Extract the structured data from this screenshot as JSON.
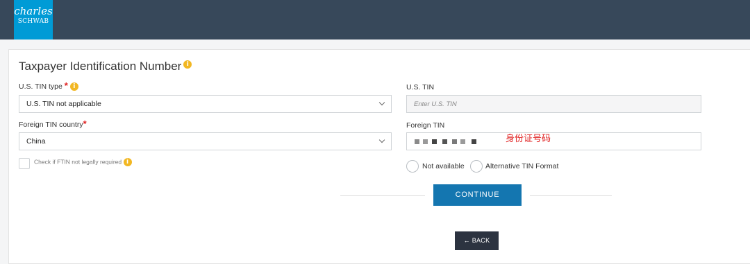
{
  "brand": {
    "line1": "charles",
    "line2": "SCHWAB",
    "color": "#009bd6"
  },
  "header_bg": "#37485a",
  "title": "Taxpayer Identification Number",
  "us_tin_type": {
    "label": "U.S. TIN type",
    "required": "*",
    "value": "U.S. TIN not applicable"
  },
  "us_tin": {
    "label": "U.S. TIN",
    "placeholder": "Enter U.S. TIN"
  },
  "foreign_country": {
    "label": "Foreign TIN country",
    "required": "*",
    "value": "China"
  },
  "foreign_tin": {
    "label": "Foreign TIN",
    "annotation": "身份证号码"
  },
  "ftin_check": {
    "label": "Check if FTIN not legally required"
  },
  "radios": {
    "not_available": "Not available",
    "alternative": "Alternative TIN Format"
  },
  "buttons": {
    "continue": "CONTINUE",
    "back": "BACK",
    "back_arrow": "←"
  },
  "icons": {
    "info": "i"
  },
  "colors": {
    "primary": "#1476b0",
    "back": "#2c3340",
    "required": "#e02020",
    "info": "#f2b722"
  }
}
